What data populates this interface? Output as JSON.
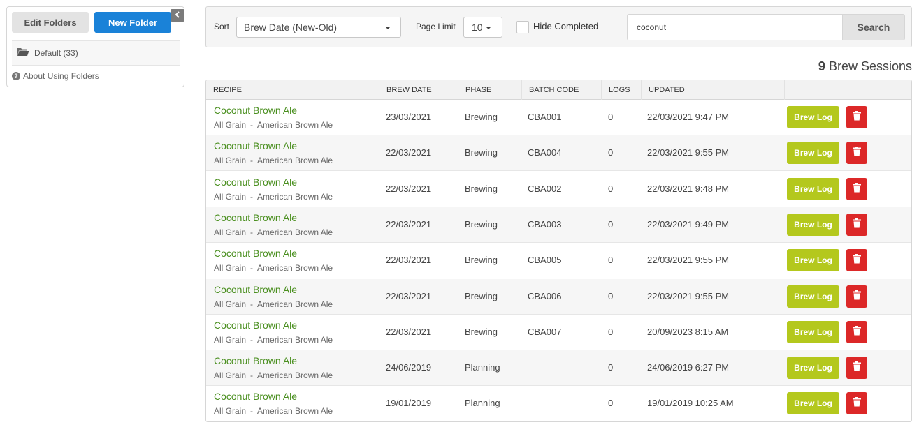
{
  "sidebar": {
    "edit_folders": "Edit Folders",
    "new_folder": "New Folder",
    "collapse_icon": "chevron-left-icon",
    "folder_icon": "open-folder-icon",
    "folder_label": "Default (33)",
    "about_icon": "question-circle-icon",
    "about_label": "About Using Folders"
  },
  "filters": {
    "sort_label": "Sort",
    "sort_value": "Brew Date (New-Old)",
    "page_limit_label": "Page Limit",
    "page_limit_value": "10",
    "hide_completed_label": "Hide Completed",
    "hide_completed_checked": false,
    "search_value": "coconut",
    "search_button": "Search"
  },
  "results": {
    "count": "9",
    "label": "Brew Sessions"
  },
  "table": {
    "headers": [
      "RECIPE",
      "BREW DATE",
      "PHASE",
      "BATCH CODE",
      "LOGS",
      "UPDATED"
    ],
    "brew_log_label": "Brew Log",
    "delete_icon": "trash-icon",
    "rows": [
      {
        "name": "Coconut Brown Ale",
        "method": "All Grain",
        "sep": "-",
        "style": "American Brown Ale",
        "brew_date": "23/03/2021",
        "phase": "Brewing",
        "batch_code": "CBA001",
        "logs": "0",
        "updated": "22/03/2021 9:47 PM"
      },
      {
        "name": "Coconut Brown Ale",
        "method": "All Grain",
        "sep": "-",
        "style": "American Brown Ale",
        "brew_date": "22/03/2021",
        "phase": "Brewing",
        "batch_code": "CBA004",
        "logs": "0",
        "updated": "22/03/2021 9:55 PM"
      },
      {
        "name": "Coconut Brown Ale",
        "method": "All Grain",
        "sep": "-",
        "style": "American Brown Ale",
        "brew_date": "22/03/2021",
        "phase": "Brewing",
        "batch_code": "CBA002",
        "logs": "0",
        "updated": "22/03/2021 9:48 PM"
      },
      {
        "name": "Coconut Brown Ale",
        "method": "All Grain",
        "sep": "-",
        "style": "American Brown Ale",
        "brew_date": "22/03/2021",
        "phase": "Brewing",
        "batch_code": "CBA003",
        "logs": "0",
        "updated": "22/03/2021 9:49 PM"
      },
      {
        "name": "Coconut Brown Ale",
        "method": "All Grain",
        "sep": "-",
        "style": "American Brown Ale",
        "brew_date": "22/03/2021",
        "phase": "Brewing",
        "batch_code": "CBA005",
        "logs": "0",
        "updated": "22/03/2021 9:55 PM"
      },
      {
        "name": "Coconut Brown Ale",
        "method": "All Grain",
        "sep": "-",
        "style": "American Brown Ale",
        "brew_date": "22/03/2021",
        "phase": "Brewing",
        "batch_code": "CBA006",
        "logs": "0",
        "updated": "22/03/2021 9:55 PM"
      },
      {
        "name": "Coconut Brown Ale",
        "method": "All Grain",
        "sep": "-",
        "style": "American Brown Ale",
        "brew_date": "22/03/2021",
        "phase": "Brewing",
        "batch_code": "CBA007",
        "logs": "0",
        "updated": "20/09/2023 8:15 AM"
      },
      {
        "name": "Coconut Brown Ale",
        "method": "All Grain",
        "sep": "-",
        "style": "American Brown Ale",
        "brew_date": "24/06/2019",
        "phase": "Planning",
        "batch_code": "",
        "logs": "0",
        "updated": "24/06/2019 6:27 PM"
      },
      {
        "name": "Coconut Brown Ale",
        "method": "All Grain",
        "sep": "-",
        "style": "American Brown Ale",
        "brew_date": "19/01/2019",
        "phase": "Planning",
        "batch_code": "",
        "logs": "0",
        "updated": "19/01/2019 10:25 AM"
      }
    ]
  },
  "colors": {
    "primary_blue": "#1a82d8",
    "recipe_green": "#4a8f1f",
    "brew_log_lime": "#b4c81d",
    "delete_red": "#dc2828"
  }
}
